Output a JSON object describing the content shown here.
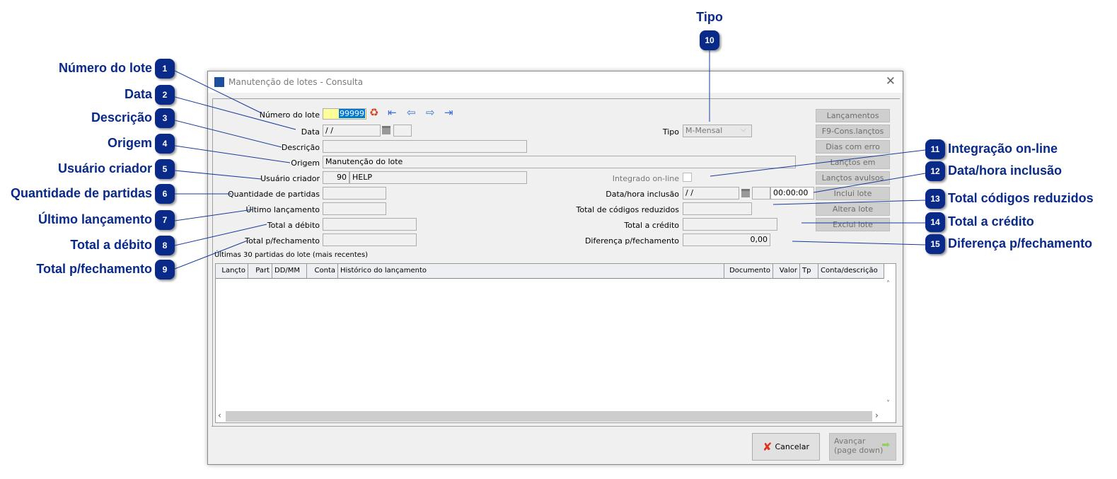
{
  "window": {
    "title": "Manutenção de lotes - Consulta",
    "close_icon": "close-icon"
  },
  "form": {
    "numero_lote": {
      "label": "Número do lote",
      "value": "99999"
    },
    "data": {
      "label": "Data",
      "value": " /  /"
    },
    "descricao": {
      "label": "Descrição",
      "value": ""
    },
    "origem": {
      "label": "Origem",
      "value": "Manutenção do lote"
    },
    "usuario": {
      "label": "Usuário criador",
      "code": "90",
      "name": "HELP"
    },
    "quantidade": {
      "label": "Quantidade de partidas",
      "value": ""
    },
    "ultimo": {
      "label": "Último lançamento",
      "value": ""
    },
    "total_debito": {
      "label": "Total a débito",
      "value": ""
    },
    "total_fechamento": {
      "label": "Total p/fechamento",
      "value": ""
    },
    "tipo": {
      "label": "Tipo",
      "value": "M-Mensal"
    },
    "integrado": {
      "label": "Integrado on-line",
      "checked": false
    },
    "data_hora": {
      "label": "Data/hora inclusão",
      "date": " /  /",
      "time": "00:00:00"
    },
    "total_codigos": {
      "label": "Total de códigos reduzidos",
      "value": ""
    },
    "total_credito": {
      "label": "Total a crédito",
      "value": ""
    },
    "diferenca": {
      "label": "Diferença p/fechamento",
      "value": "0,00"
    }
  },
  "side_buttons": [
    "Lançamentos",
    "F9-Cons.lançtos",
    "Dias com erro",
    "Lançtos em aberto",
    "Lançtos avulsos",
    "Inclui lote",
    "Altera lote",
    "Exclui lote"
  ],
  "table": {
    "caption": "Últimas 30 partidas do lote (mais recentes)",
    "columns": [
      "Lançto",
      "Part",
      "DD/MM",
      "Conta",
      "Histórico do lançamento",
      "Documento",
      "Valor",
      "Tp",
      "Conta/descrição"
    ],
    "rows": []
  },
  "footer": {
    "cancel": "Cancelar",
    "next_line1": "Avançar",
    "next_line2": "(page down)"
  },
  "callouts": [
    {
      "n": "1",
      "text": "Número do lote"
    },
    {
      "n": "2",
      "text": "Data"
    },
    {
      "n": "3",
      "text": "Descrição"
    },
    {
      "n": "4",
      "text": "Origem"
    },
    {
      "n": "5",
      "text": "Usuário criador"
    },
    {
      "n": "6",
      "text": "Quantidade de partidas"
    },
    {
      "n": "7",
      "text": "Último lançamento"
    },
    {
      "n": "8",
      "text": "Total a débito"
    },
    {
      "n": "9",
      "text": "Total p/fechamento"
    },
    {
      "n": "10",
      "text": "Tipo"
    },
    {
      "n": "11",
      "text": "Integração on-line"
    },
    {
      "n": "12",
      "text": "Data/hora inclusão"
    },
    {
      "n": "13",
      "text": "Total códigos reduzidos"
    },
    {
      "n": "14",
      "text": "Total a crédito"
    },
    {
      "n": "15",
      "text": "Diferença p/fechamento"
    }
  ],
  "colors": {
    "callout": "#0a2a8a",
    "highlight_input": "#ffff99",
    "selection": "#0078d7"
  }
}
